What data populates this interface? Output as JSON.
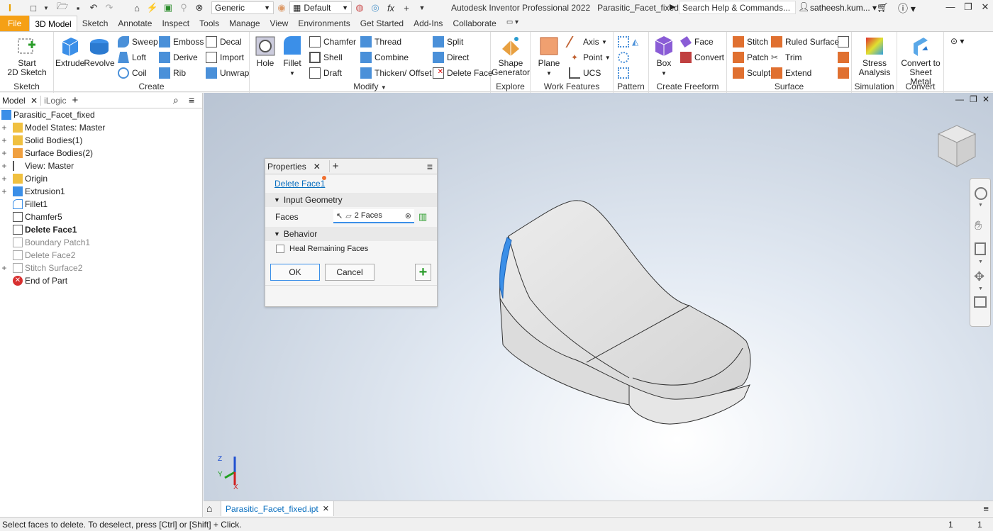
{
  "titlebar": {
    "appearance_select": "Generic",
    "material_select": "Default",
    "app_title": "Autodesk Inventor Professional 2022",
    "file_title": "Parasitic_Facet_fixed",
    "search_placeholder": "Search Help & Commands...",
    "user_name": "satheesh.kum..."
  },
  "ribbon_tabs": [
    "File",
    "3D Model",
    "Sketch",
    "Annotate",
    "Inspect",
    "Tools",
    "Manage",
    "View",
    "Environments",
    "Get Started",
    "Add-Ins",
    "Collaborate"
  ],
  "ribbon": {
    "sketch": {
      "title": "Sketch",
      "start_sketch": "Start\n2D Sketch"
    },
    "create": {
      "title": "Create",
      "extrude": "Extrude",
      "revolve": "Revolve",
      "sweep": "Sweep",
      "emboss": "Emboss",
      "decal": "Decal",
      "loft": "Loft",
      "derive": "Derive",
      "import": "Import",
      "coil": "Coil",
      "rib": "Rib",
      "unwrap": "Unwrap"
    },
    "modify": {
      "title": "Modify",
      "hole": "Hole",
      "fillet": "Fillet",
      "chamfer": "Chamfer",
      "thread": "Thread",
      "split": "Split",
      "shell": "Shell",
      "combine": "Combine",
      "direct": "Direct",
      "draft": "Draft",
      "thicken": "Thicken/ Offset",
      "delete_face": "Delete Face"
    },
    "explore": {
      "title": "Explore",
      "shape_generator": "Shape\nGenerator"
    },
    "work_features": {
      "title": "Work Features",
      "plane": "Plane",
      "axis": "Axis",
      "point": "Point",
      "ucs": "UCS"
    },
    "pattern": {
      "title": "Pattern"
    },
    "freeform": {
      "title": "Create Freeform",
      "box": "Box",
      "face": "Face",
      "convert": "Convert"
    },
    "surface": {
      "title": "Surface",
      "stitch": "Stitch",
      "ruled_surface": "Ruled Surface",
      "patch": "Patch",
      "trim": "Trim",
      "sculpt": "Sculpt",
      "extend": "Extend"
    },
    "simulation": {
      "title": "Simulation",
      "stress": "Stress\nAnalysis"
    },
    "convert": {
      "title": "Convert",
      "sheet_metal": "Convert to\nSheet Metal"
    }
  },
  "browser": {
    "tab_model": "Model",
    "tab_ilogic": "iLogic",
    "items": [
      {
        "label": "Parasitic_Facet_fixed"
      },
      {
        "label": "Model States: Master"
      },
      {
        "label": "Solid Bodies(1)"
      },
      {
        "label": "Surface Bodies(2)"
      },
      {
        "label": "View: Master"
      },
      {
        "label": "Origin"
      },
      {
        "label": "Extrusion1"
      },
      {
        "label": "Fillet1"
      },
      {
        "label": "Chamfer5"
      },
      {
        "label": "Delete Face1"
      },
      {
        "label": "Boundary Patch1"
      },
      {
        "label": "Delete Face2"
      },
      {
        "label": "Stitch Surface2"
      },
      {
        "label": "End of Part"
      }
    ]
  },
  "properties": {
    "tab_title": "Properties",
    "feature_name": "Delete Face1",
    "input_geometry": "Input Geometry",
    "faces_label": "Faces",
    "faces_value": "2 Faces",
    "behavior": "Behavior",
    "heal_label": "Heal Remaining Faces",
    "ok": "OK",
    "cancel": "Cancel"
  },
  "doc_tab": "Parasitic_Facet_fixed.ipt",
  "status": {
    "message": "Select faces to delete. To deselect, press [Ctrl] or [Shift] + Click.",
    "count1": "1",
    "count2": "1"
  },
  "axis_labels": {
    "x": "X",
    "y": "Y",
    "z": "Z"
  },
  "colors": {
    "file_tab": "#f5a015",
    "selection_blue": "#3b8fe8",
    "link_blue": "#0a6fbf"
  }
}
